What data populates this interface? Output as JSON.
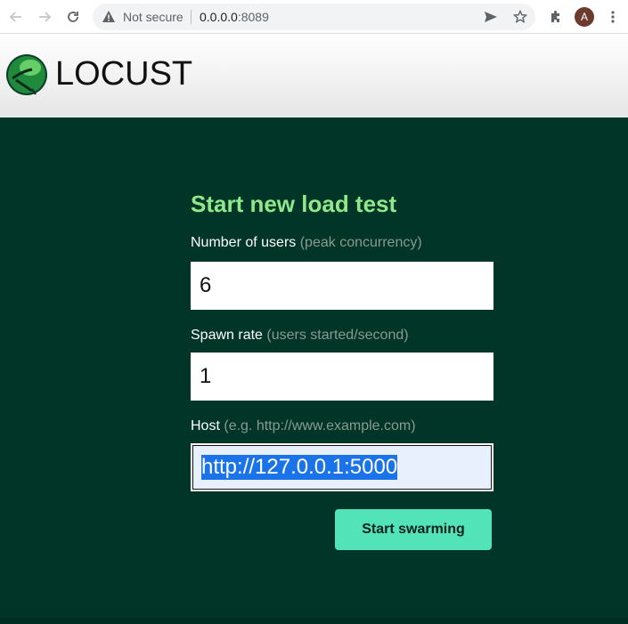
{
  "browser": {
    "security_label": "Not secure",
    "url_host": "0.0.0.0",
    "url_port": ":8089",
    "avatar_letter": "A"
  },
  "header": {
    "logo_text": "LOCUST"
  },
  "form": {
    "title": "Start new load test",
    "users_label": "Number of users",
    "users_hint": "(peak concurrency)",
    "users_value": "6",
    "spawn_label": "Spawn rate",
    "spawn_hint": "(users started/second)",
    "spawn_value": "1",
    "host_label": "Host",
    "host_hint": "(e.g. http://www.example.com)",
    "host_value": "http://127.0.0.1:5000",
    "submit_label": "Start swarming"
  },
  "colors": {
    "background": "#003527",
    "title": "#8fe88a",
    "button": "#53e3b9",
    "hint": "#8a9a92"
  },
  "icons": [
    "back-arrow-icon",
    "forward-arrow-icon",
    "reload-icon",
    "warning-icon",
    "send-icon",
    "star-icon",
    "extensions-icon",
    "more-icon",
    "locust-logo-icon"
  ]
}
